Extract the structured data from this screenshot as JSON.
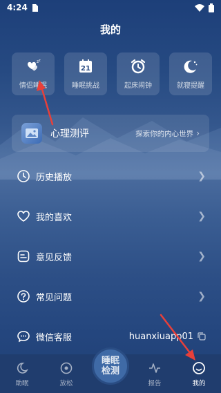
{
  "status": {
    "time": "4:24"
  },
  "page_title": "我的",
  "features": [
    {
      "label": "情侣睡眠",
      "icon": "hearts-zz-icon"
    },
    {
      "label": "睡眠挑战",
      "icon": "calendar-21-icon",
      "calendar_number": "21"
    },
    {
      "label": "起床闹钟",
      "icon": "alarm-clock-icon"
    },
    {
      "label": "就寝提醒",
      "icon": "moon-stars-icon"
    }
  ],
  "psych": {
    "title": "心理测评",
    "subtitle": "探索你的内心世界",
    "arrow": "›"
  },
  "menu": [
    {
      "label": "历史播放",
      "icon": "clock-icon"
    },
    {
      "label": "我的喜欢",
      "icon": "heart-icon"
    },
    {
      "label": "意见反馈",
      "icon": "feedback-icon"
    },
    {
      "label": "常见问题",
      "icon": "question-icon"
    },
    {
      "label": "微信客服",
      "icon": "wechat-service-icon",
      "value": "huanxiuapp01"
    }
  ],
  "tabs": [
    {
      "label": "助眠",
      "icon": "moon-icon"
    },
    {
      "label": "放松",
      "icon": "disc-icon"
    },
    {
      "label": "睡眠检测",
      "line1": "睡眠",
      "line2": "检测"
    },
    {
      "label": "报告",
      "icon": "pulse-icon"
    },
    {
      "label": "我的",
      "icon": "smile-icon",
      "active": true
    }
  ],
  "colors": {
    "annotation_arrow": "#e8403a",
    "background": "#2a4c84",
    "tabbar": "#203d6e"
  }
}
